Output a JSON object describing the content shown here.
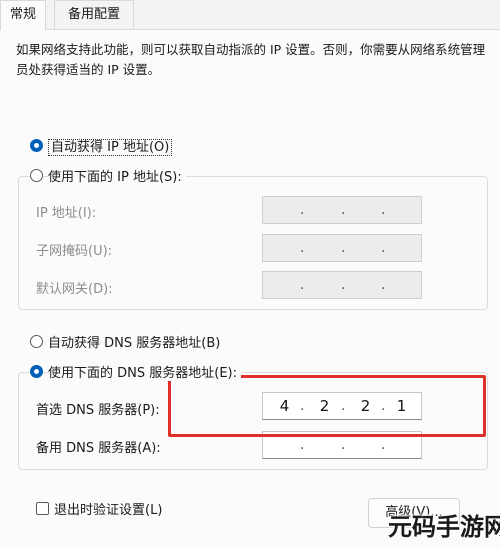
{
  "tabs": [
    {
      "label": "常规",
      "active": true
    },
    {
      "label": "备用配置",
      "active": false
    }
  ],
  "description": "如果网络支持此功能，则可以获取自动指派的 IP 设置。否则，你需要从网络系统管理员处获得适当的 IP 设置。",
  "ip": {
    "auto_label": "自动获得 IP 地址(O)",
    "manual_label": "使用下面的 IP 地址(S):",
    "auto_selected": true,
    "fields": [
      {
        "label": "IP 地址(I):",
        "value": [
          "",
          "",
          "",
          ""
        ]
      },
      {
        "label": "子网掩码(U):",
        "value": [
          "",
          "",
          "",
          ""
        ]
      },
      {
        "label": "默认网关(D):",
        "value": [
          "",
          "",
          "",
          ""
        ]
      }
    ]
  },
  "dns": {
    "auto_label": "自动获得 DNS 服务器地址(B)",
    "manual_label": "使用下面的 DNS 服务器地址(E):",
    "manual_selected": true,
    "preferred": {
      "label": "首选 DNS 服务器(P):",
      "value": [
        "4",
        "2",
        "2",
        "1"
      ]
    },
    "alternate": {
      "label": "备用 DNS 服务器(A):",
      "value": [
        "",
        "",
        "",
        ""
      ]
    }
  },
  "validate_on_exit": {
    "label": "退出时验证设置(L)",
    "checked": false
  },
  "advanced_button": "高级(V)...",
  "watermark": "元码手游网",
  "colors": {
    "accent": "#005fb8",
    "highlight": "#e0302c"
  }
}
